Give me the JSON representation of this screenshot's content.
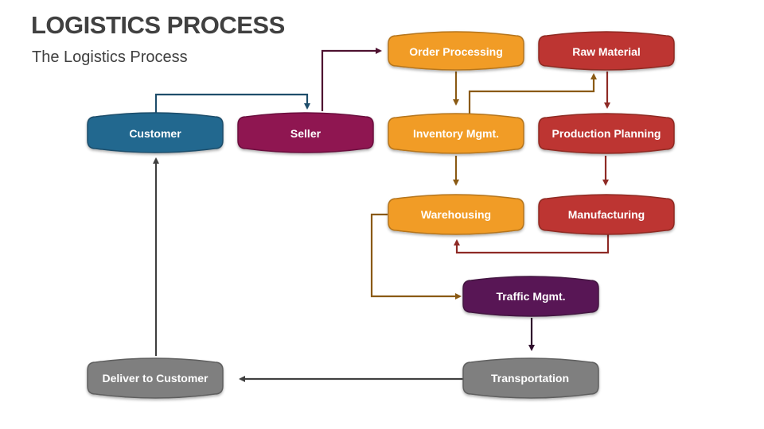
{
  "header": {
    "title": "LOGISTICS PROCESS",
    "subtitle": "The Logistics Process"
  },
  "colors": {
    "customer": "#24678f",
    "seller": "#8f1551",
    "order": "#f19c27",
    "raw": "#bd3630",
    "traffic": "#581855",
    "gray": "#7f7f7f"
  },
  "nodes": {
    "customer": "Customer",
    "seller": "Seller",
    "order_processing": "Order Processing",
    "raw_material": "Raw Material",
    "inventory_mgmt": "Inventory Mgmt.",
    "production_planning": "Production Planning",
    "warehousing": "Warehousing",
    "manufacturing": "Manufacturing",
    "traffic_mgmt": "Traffic Mgmt.",
    "transportation": "Transportation",
    "deliver_to_customer": "Deliver to Customer"
  },
  "edges": [
    {
      "from": "Customer",
      "to": "Seller"
    },
    {
      "from": "Seller",
      "to": "Order Processing"
    },
    {
      "from": "Order Processing",
      "to": "Inventory Mgmt."
    },
    {
      "from": "Inventory Mgmt.",
      "to": "Raw Material"
    },
    {
      "from": "Raw Material",
      "to": "Production Planning"
    },
    {
      "from": "Inventory Mgmt.",
      "to": "Warehousing"
    },
    {
      "from": "Production Planning",
      "to": "Manufacturing"
    },
    {
      "from": "Manufacturing",
      "to": "Warehousing"
    },
    {
      "from": "Warehousing",
      "to": "Traffic Mgmt."
    },
    {
      "from": "Traffic Mgmt.",
      "to": "Transportation"
    },
    {
      "from": "Transportation",
      "to": "Deliver to Customer"
    },
    {
      "from": "Deliver to Customer",
      "to": "Customer"
    }
  ]
}
